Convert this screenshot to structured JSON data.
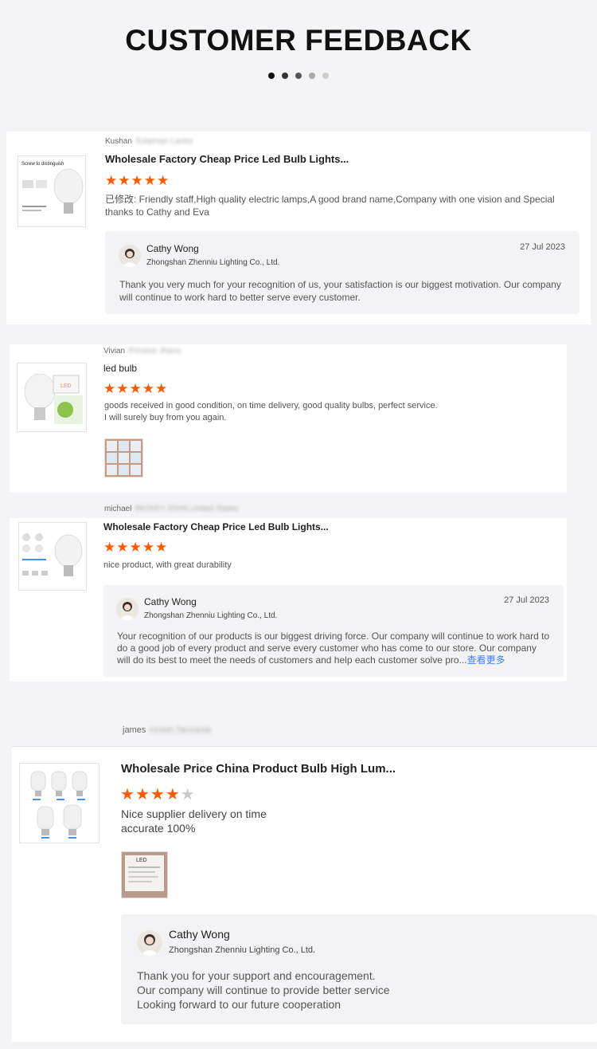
{
  "header": {
    "title": "CUSTOMER FEEDBACK",
    "dots": 5,
    "active_dot": 0
  },
  "reviews": [
    {
      "reviewer": "Kushan",
      "product_title": "Wholesale Factory Cheap Price Led Bulb Lights...",
      "thumb_text": "Screw to distinguish",
      "stars": 5,
      "text": "已修改: Friendly staff,High quality electric lamps,A good brand name,Company with one vision and Special thanks to Cathy and Eva",
      "reply": {
        "name": "Cathy Wong",
        "company": "Zhongshan Zhenniu Lighting Co., Ltd.",
        "date": "27 Jul 2023",
        "message": "Thank you very much for your recognition of us, your satisfaction is our biggest motivation. Our company will continue to work hard to better serve every customer."
      }
    },
    {
      "reviewer": "Vivian",
      "product_title": "led bulb",
      "stars": 5,
      "text_lines": [
        "goods received in good condition, on time delivery, good quality bulbs, perfect service.",
        "I will surely buy from you again."
      ]
    },
    {
      "reviewer": "michael",
      "product_title": "Wholesale Factory Cheap Price Led Bulb Lights...",
      "stars": 5,
      "text": "nice product, with great durability",
      "reply": {
        "name": "Cathy Wong",
        "company": "Zhongshan Zhenniu Lighting Co., Ltd.",
        "date": "27 Jul 2023",
        "message": "Your recognition of our products is our biggest driving force. Our company will continue to work hard to do a good job of every product and serve every customer who has come to our store. Our company will do its best to meet the needs of customers and help each customer solve pro...",
        "more": "查看更多"
      }
    },
    {
      "reviewer": "james",
      "product_title": "Wholesale Price China Product Bulb High Lum...",
      "stars": 4,
      "text_lines": [
        "Nice supplier  delivery  on time",
        "accurate 100%"
      ],
      "photo_label": "LED",
      "reply": {
        "name": "Cathy Wong",
        "company": "Zhongshan Zhenniu Lighting Co., Ltd.",
        "message_lines": [
          "Thank you for your support and encouragement.",
          "Our company will continue to provide better service",
          "Looking forward to our future cooperation"
        ]
      }
    }
  ],
  "colors": {
    "star": "#ff5a00",
    "star_off": "#c8c8c8",
    "link": "#3b82f6"
  },
  "icons": {
    "star": "star-icon",
    "avatar": "avatar-icon"
  }
}
